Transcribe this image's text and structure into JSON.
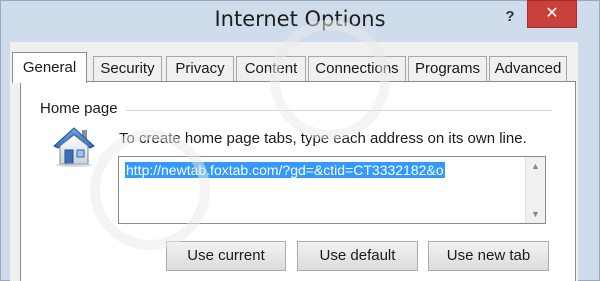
{
  "window": {
    "title": "Internet Options",
    "help_label": "?",
    "close_label": "✕"
  },
  "tabs": [
    {
      "label": "General",
      "active": true
    },
    {
      "label": "Security",
      "active": false
    },
    {
      "label": "Privacy",
      "active": false
    },
    {
      "label": "Content",
      "active": false
    },
    {
      "label": "Connections",
      "active": false
    },
    {
      "label": "Programs",
      "active": false
    },
    {
      "label": "Advanced",
      "active": false
    }
  ],
  "home_page": {
    "group_label": "Home page",
    "icon": "house-icon",
    "instruction": "To create home page tabs, type each address on its own line.",
    "url_value": "http://newtab.foxtab.com/?gd=&ctid=CT3332182&o",
    "buttons": {
      "use_current": "Use current",
      "use_default": "Use default",
      "use_new_tab": "Use new tab"
    }
  },
  "colors": {
    "selection": "#3399ff",
    "close_button": "#c7403a",
    "frame": "#cfdceb"
  }
}
